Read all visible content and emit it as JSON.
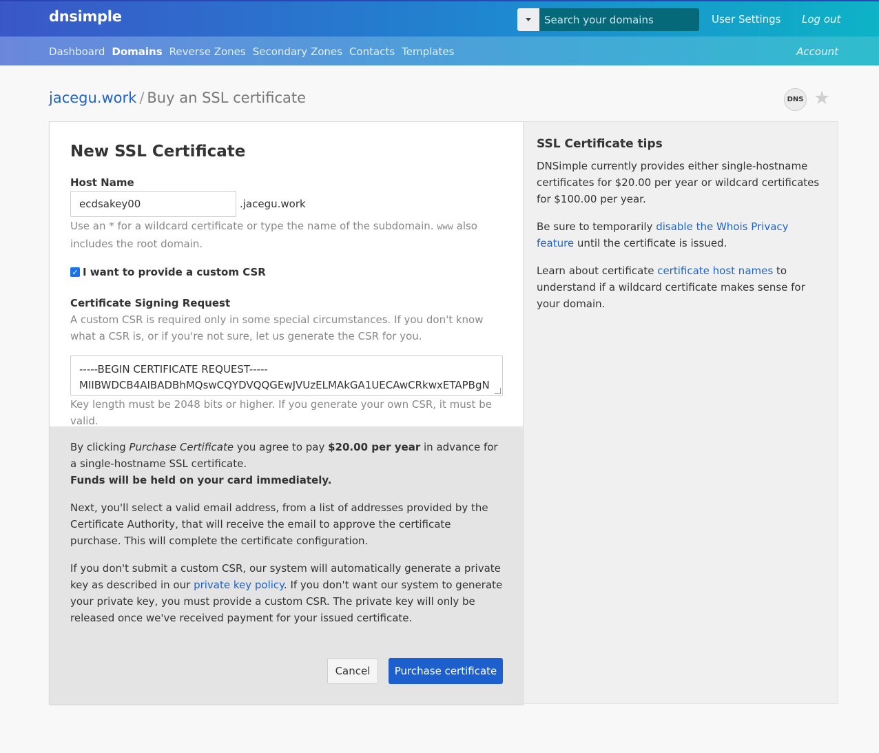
{
  "header": {
    "logo": "dnsimple",
    "search_placeholder": "Search your domains",
    "user_settings": "User Settings",
    "logout": "Log out"
  },
  "subnav": {
    "items": [
      "Dashboard",
      "Domains",
      "Reverse Zones",
      "Secondary Zones",
      "Contacts",
      "Templates"
    ],
    "active": "Domains",
    "account": "Account"
  },
  "breadcrumb": {
    "domain": "jacegu.work",
    "separator": "/",
    "current": "Buy an SSL certificate"
  },
  "badge": {
    "dns": "DNS",
    "star_icon": "star-icon"
  },
  "form": {
    "title": "New SSL Certificate",
    "host_label": "Host Name",
    "host_value": "ecdsakey00",
    "host_suffix": ".jacegu.work",
    "host_help_1": "Use an * for a wildcard certificate or type the name of the subdomain.",
    "host_help_code": "www",
    "host_help_2": "also includes the root domain.",
    "custom_csr_checked": true,
    "custom_csr_label": "I want to provide a custom CSR",
    "csr_label": "Certificate Signing Request",
    "csr_help": "A custom CSR is required only in some special circumstances. If you don't know what a CSR is, or if you're not sure, let us generate the CSR for you.",
    "csr_line1": "-----BEGIN CERTIFICATE REQUEST-----",
    "csr_line2": "MIIBWDCB4AIBADBhMQswCQYDVQQGEwJVUzELMAkGA1UECAwCRkwxETAPBgN",
    "csr_note": "Key length must be 2048 bits or higher. If you generate your own CSR, it must be valid."
  },
  "footer": {
    "p1_pre": "By clicking ",
    "p1_em": "Purchase Certificate",
    "p1_mid": " you agree to pay ",
    "p1_price": "$20.00 per year",
    "p1_post": " in advance for a single-hostname SSL certificate.",
    "p1_funds": "Funds will be held on your card immediately.",
    "p2": "Next, you'll select a valid email address, from a list of addresses provided by the Certificate Authority, that will receive the email to approve the certificate purchase. This will complete the certificate configuration.",
    "p3_pre": "If you don't submit a custom CSR, our system will automatically generate a private key as described in our ",
    "p3_link": "private key policy",
    "p3_post": ". If you don't want our system to generate your private key, you must provide a custom CSR. The private key will only be released once we've received payment for your issued certificate.",
    "cancel": "Cancel",
    "purchase": "Purchase certificate"
  },
  "tips": {
    "title": "SSL Certificate tips",
    "p1": "DNSimple currently provides either single-hostname certificates for $20.00 per year or wildcard certificates for $100.00 per year.",
    "p2_pre": "Be sure to temporarily ",
    "p2_link": "disable the Whois Privacy feature",
    "p2_post": " until the certificate is issued.",
    "p3_pre": "Learn about certificate ",
    "p3_link": "certificate host names",
    "p3_post": " to understand if a wildcard certificate makes sense for your domain."
  },
  "colors": {
    "primary": "#1c5fcd",
    "link": "#1f63c6"
  }
}
